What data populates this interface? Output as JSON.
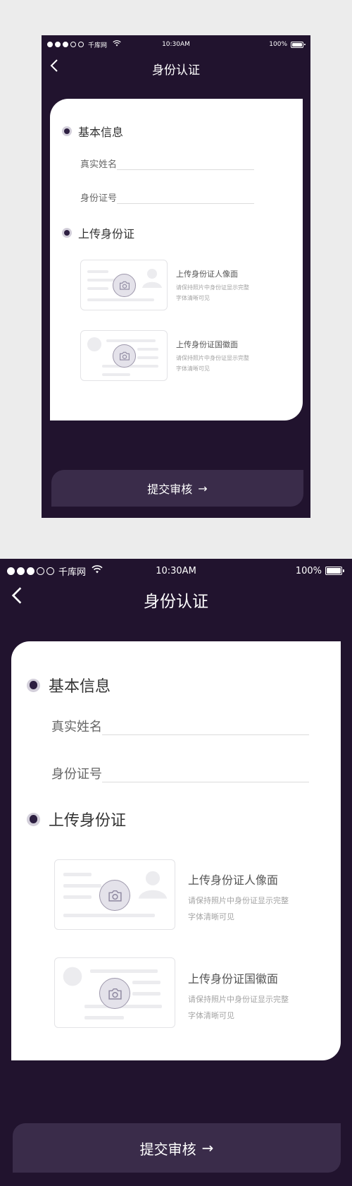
{
  "status_bar": {
    "carrier": "千库网",
    "time": "10:30AM",
    "battery": "100%",
    "battery_level": 1.0
  },
  "header": {
    "title": "身份认证",
    "back_icon": "chevron-left-icon"
  },
  "basic_info": {
    "title": "基本信息",
    "fields": [
      {
        "label": "真实姓名",
        "value": ""
      },
      {
        "label": "身份证号",
        "value": ""
      }
    ]
  },
  "upload": {
    "title": "上传身份证",
    "items": [
      {
        "title": "上传身份证人像面",
        "hint1": "请保持照片中身份证显示完整",
        "hint2": "字体清晰可见",
        "icon": "camera-icon"
      },
      {
        "title": "上传身份证国徽面",
        "hint1": "请保持照片中身份证显示完整",
        "hint2": "字体清晰可见",
        "icon": "camera-icon"
      }
    ]
  },
  "submit": {
    "label": "提交审核",
    "arrow": "→"
  },
  "colors": {
    "background": "#21132e",
    "accent": "#3a2c4a",
    "card": "#ffffff",
    "radio": "#2d1f41"
  }
}
